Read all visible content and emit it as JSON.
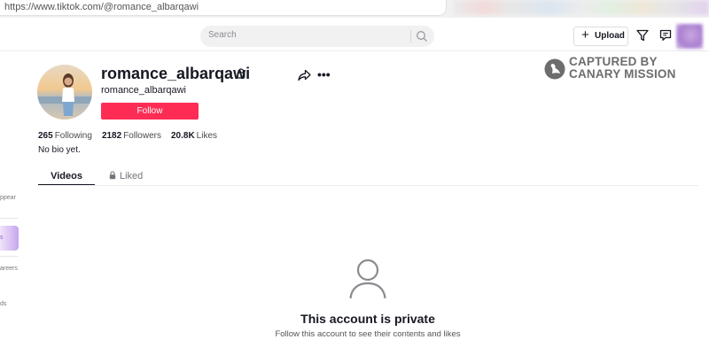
{
  "browser": {
    "url": "https://www.tiktok.com/@romance_albarqawi"
  },
  "header": {
    "search_placeholder": "Search",
    "upload_label": "Upload",
    "icons": [
      "search-icon",
      "plus-icon",
      "filter-icon",
      "inbox-icon"
    ]
  },
  "sidebar": {
    "fragments": [
      "ppear",
      "s",
      "areers",
      "ds"
    ]
  },
  "profile": {
    "username": "romance_albarqawi",
    "nickname": "romance_albarqawi",
    "follow_label": "Follow",
    "stats": {
      "following": "265",
      "following_label": "Following",
      "followers": "2182",
      "followers_label": "Followers",
      "likes": "20.8K",
      "likes_label": "Likes"
    },
    "bio": "No bio yet.",
    "tabs": [
      {
        "label": "Videos",
        "active": true
      },
      {
        "label": "Liked",
        "active": false
      }
    ]
  },
  "watermark": {
    "line1": "CAPTURED BY",
    "line2": "CANARY MISSION"
  },
  "private_notice": {
    "title": "This account is private",
    "subtitle": "Follow this account to see their contents and likes"
  },
  "colors": {
    "accent": "#fe2c55",
    "text": "#161823",
    "watermark": "#6d6d6d"
  }
}
